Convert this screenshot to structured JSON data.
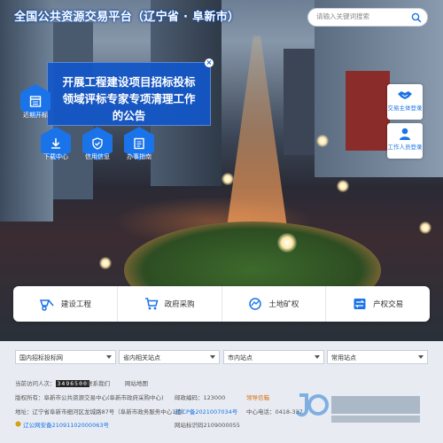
{
  "site": {
    "title": "全国公共资源交易平台（辽宁省 · 阜新市）"
  },
  "search": {
    "placeholder": "请输入关键词搜索"
  },
  "notice": {
    "line1": "开展工程建设项目招标投标",
    "line2": "领域评标专家专项清理工作的公告",
    "close": "×"
  },
  "hex_nav": [
    {
      "label": "近期开标",
      "icon": "calendar-icon"
    },
    {
      "label": "下载中心",
      "icon": "download-icon"
    },
    {
      "label": "信用信息",
      "icon": "shield-icon"
    },
    {
      "label": "办事指南",
      "icon": "book-icon"
    }
  ],
  "side_buttons": [
    {
      "label": "交易主体登录",
      "icon": "handshake-icon"
    },
    {
      "label": "工作人员登录",
      "icon": "person-icon"
    }
  ],
  "services": [
    {
      "label": "建设工程",
      "icon": "wheelbarrow-icon"
    },
    {
      "label": "政府采购",
      "icon": "cart-icon"
    },
    {
      "label": "土地矿权",
      "icon": "land-icon"
    },
    {
      "label": "产权交易",
      "icon": "exchange-icon"
    }
  ],
  "footer": {
    "selects": [
      "国内招标投标网",
      "省内相关站点",
      "市内站点",
      "常用站点"
    ],
    "visitors_label": "当前访问人次：",
    "visitors_count": "3496500",
    "contact": "联系我们",
    "sitemap": "网站地图",
    "sponsor": "版权所有：阜新市公共资源交易中心(阜新市政府采购中心)",
    "postcode": "邮政编码：123000",
    "leader": "领导信箱",
    "address": "地址：辽宁省阜新市细河区龙城路87号（阜新市政务服务中心1楼）",
    "icp": "辽ICP备2021007034号",
    "phone": "中心电话：0418-337",
    "police": "辽公网安备21091102000063号",
    "site_id": "网站标识码2109000055"
  },
  "colors": {
    "accent": "#1a73e8",
    "notice_bg": "#1256c8",
    "title_glow": "#0a4cb3"
  }
}
